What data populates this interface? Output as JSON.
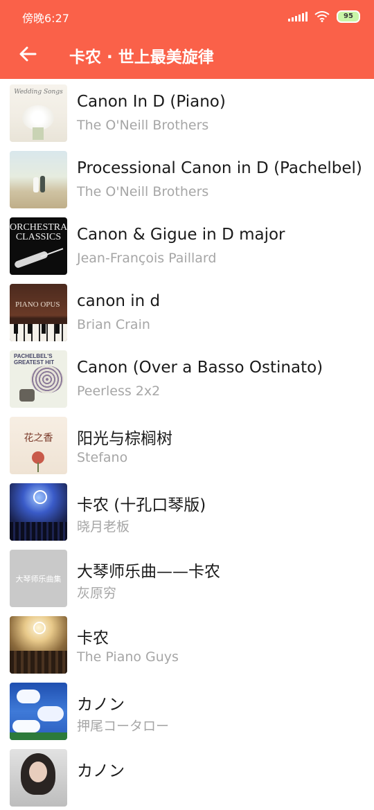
{
  "status_bar": {
    "time": "傍晚6:27",
    "battery": "95"
  },
  "app_bar": {
    "title": "卡农 · 世上最美旋律"
  },
  "tracks": [
    {
      "title": "Canon In D (Piano)",
      "artist": "The O'Neill Brothers",
      "cover_text": "Wedding Songs"
    },
    {
      "title": "Processional Canon in D (Pachelbel)",
      "artist": "The O'Neill Brothers",
      "cover_text": ""
    },
    {
      "title": "Canon & Gigue in D major",
      "artist": "Jean-François Paillard",
      "cover_text": "ORCHESTRAL CLASSICS"
    },
    {
      "title": "canon in d",
      "artist": "Brian Crain",
      "cover_text": "PIANO OPUS"
    },
    {
      "title": "Canon (Over a Basso Ostinato)",
      "artist": "Peerless 2x2",
      "cover_text": "PACHELBEL'S GREATEST HIT"
    },
    {
      "title": "阳光与棕榈树",
      "artist": "Stefano",
      "cover_text": "花之香"
    },
    {
      "title": "卡农 (十孔口琴版)",
      "artist": "晓月老板",
      "cover_text": ""
    },
    {
      "title": "大琴师乐曲——卡农",
      "artist": "灰原穷",
      "cover_text": "大琴师乐曲集"
    },
    {
      "title": "卡农",
      "artist": "The Piano Guys",
      "cover_text": ""
    },
    {
      "title": "カノン",
      "artist": "押尾コータロー",
      "cover_text": ""
    },
    {
      "title": "カノン",
      "artist": "",
      "cover_text": ""
    }
  ],
  "colors": {
    "accent": "#fa6149",
    "title_text": "#1a1a1a",
    "artist_text": "#a6a6a6"
  }
}
